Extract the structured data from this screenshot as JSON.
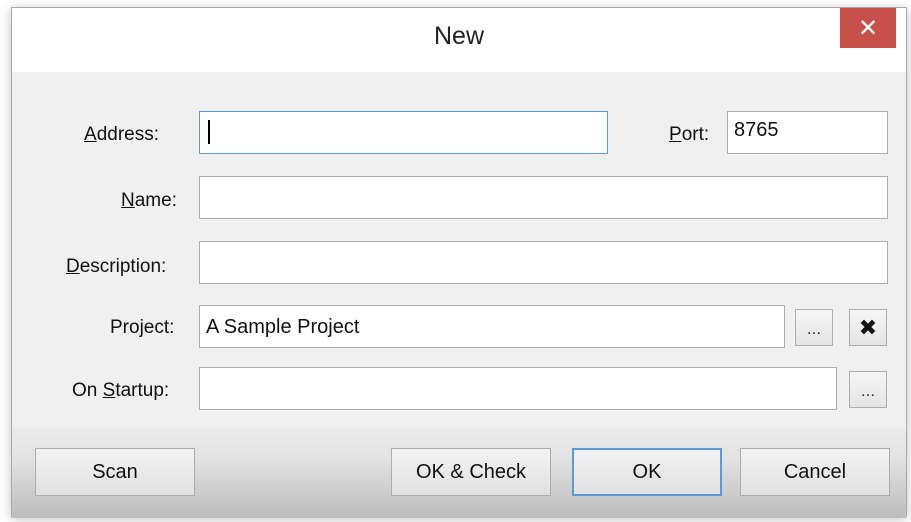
{
  "window": {
    "title": "New",
    "close_glyph": "✕"
  },
  "form": {
    "address": {
      "label_hot": "A",
      "label_rest": "ddress:",
      "value": ""
    },
    "port": {
      "label_hot": "P",
      "label_rest": "ort:",
      "value": "8765"
    },
    "name": {
      "label_hot": "N",
      "label_rest": "ame:",
      "value": ""
    },
    "description": {
      "label_hot": "D",
      "label_rest": "escription:",
      "value": ""
    },
    "project": {
      "label": "Project:",
      "value": "A Sample Project",
      "browse_label": "...",
      "clear_glyph": "✖"
    },
    "on_startup": {
      "label_pre": "On ",
      "label_hot": "S",
      "label_rest": "tartup:",
      "value": "",
      "browse_label": "..."
    }
  },
  "buttons": {
    "scan": "Scan",
    "ok_check": "OK & Check",
    "ok": "OK",
    "cancel": "Cancel"
  }
}
